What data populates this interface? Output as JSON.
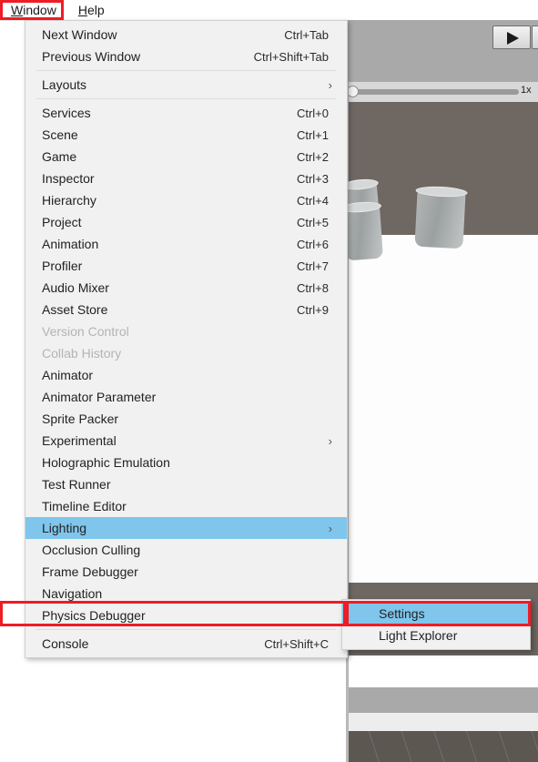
{
  "menubar": {
    "items": [
      {
        "label": "Window",
        "mnemonic": "W",
        "rest": "indow",
        "active": true
      },
      {
        "label": "Help",
        "mnemonic": "H",
        "rest": "elp",
        "active": false
      }
    ]
  },
  "window_menu": {
    "groups": [
      {
        "items": [
          {
            "label": "Next Window",
            "shortcut": "Ctrl+Tab",
            "arrow": "",
            "state": "enabled"
          },
          {
            "label": "Previous Window",
            "shortcut": "Ctrl+Shift+Tab",
            "arrow": "",
            "state": "enabled"
          }
        ]
      },
      {
        "items": [
          {
            "label": "Layouts",
            "shortcut": "",
            "arrow": "›",
            "state": "enabled"
          }
        ]
      },
      {
        "items": [
          {
            "label": "Services",
            "shortcut": "Ctrl+0",
            "arrow": "",
            "state": "enabled"
          },
          {
            "label": "Scene",
            "shortcut": "Ctrl+1",
            "arrow": "",
            "state": "enabled"
          },
          {
            "label": "Game",
            "shortcut": "Ctrl+2",
            "arrow": "",
            "state": "enabled"
          },
          {
            "label": "Inspector",
            "shortcut": "Ctrl+3",
            "arrow": "",
            "state": "enabled"
          },
          {
            "label": "Hierarchy",
            "shortcut": "Ctrl+4",
            "arrow": "",
            "state": "enabled"
          },
          {
            "label": "Project",
            "shortcut": "Ctrl+5",
            "arrow": "",
            "state": "enabled"
          },
          {
            "label": "Animation",
            "shortcut": "Ctrl+6",
            "arrow": "",
            "state": "enabled"
          },
          {
            "label": "Profiler",
            "shortcut": "Ctrl+7",
            "arrow": "",
            "state": "enabled"
          },
          {
            "label": "Audio Mixer",
            "shortcut": "Ctrl+8",
            "arrow": "",
            "state": "enabled"
          },
          {
            "label": "Asset Store",
            "shortcut": "Ctrl+9",
            "arrow": "",
            "state": "enabled"
          },
          {
            "label": "Version Control",
            "shortcut": "",
            "arrow": "",
            "state": "disabled"
          },
          {
            "label": "Collab History",
            "shortcut": "",
            "arrow": "",
            "state": "disabled"
          },
          {
            "label": "Animator",
            "shortcut": "",
            "arrow": "",
            "state": "enabled"
          },
          {
            "label": "Animator Parameter",
            "shortcut": "",
            "arrow": "",
            "state": "enabled"
          },
          {
            "label": "Sprite Packer",
            "shortcut": "",
            "arrow": "",
            "state": "enabled"
          },
          {
            "label": "Experimental",
            "shortcut": "",
            "arrow": "›",
            "state": "enabled"
          },
          {
            "label": "Holographic Emulation",
            "shortcut": "",
            "arrow": "",
            "state": "enabled"
          },
          {
            "label": "Test Runner",
            "shortcut": "",
            "arrow": "",
            "state": "enabled"
          },
          {
            "label": "Timeline Editor",
            "shortcut": "",
            "arrow": "",
            "state": "enabled"
          },
          {
            "label": "Lighting",
            "shortcut": "",
            "arrow": "›",
            "state": "highlighted"
          },
          {
            "label": "Occlusion Culling",
            "shortcut": "",
            "arrow": "",
            "state": "enabled"
          },
          {
            "label": "Frame Debugger",
            "shortcut": "",
            "arrow": "",
            "state": "enabled"
          },
          {
            "label": "Navigation",
            "shortcut": "",
            "arrow": "",
            "state": "enabled"
          },
          {
            "label": "Physics Debugger",
            "shortcut": "",
            "arrow": "",
            "state": "enabled"
          }
        ]
      },
      {
        "items": [
          {
            "label": "Console",
            "shortcut": "Ctrl+Shift+C",
            "arrow": "",
            "state": "enabled"
          }
        ]
      }
    ]
  },
  "lighting_submenu": {
    "items": [
      {
        "label": "Settings",
        "shortcut": "",
        "arrow": "",
        "state": "highlighted"
      },
      {
        "label": "Light Explorer",
        "shortcut": "",
        "arrow": "",
        "state": "enabled"
      }
    ]
  },
  "background": {
    "playback_speed_label": "1x"
  },
  "colors": {
    "highlight": "#7fc5ec",
    "annotation": "#ee1c25",
    "menu_bg": "#f1f1f1",
    "disabled_text": "#b4b4b4"
  }
}
